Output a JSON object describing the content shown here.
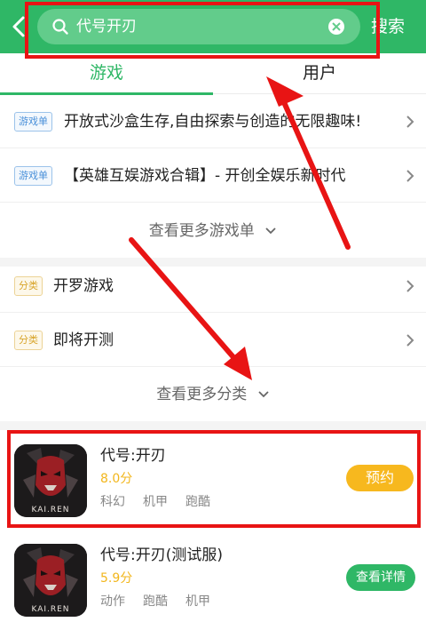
{
  "header": {
    "search_value": "代号开刃",
    "search_button": "搜索"
  },
  "tabs": [
    {
      "label": "游戏",
      "active": true
    },
    {
      "label": "用户",
      "active": false
    }
  ],
  "playlists": [
    {
      "tag": "游戏单",
      "text": "开放式沙盒生存,自由探索与创造的无限趣味!"
    },
    {
      "tag": "游戏单",
      "text": "【英雄互娱游戏合辑】- 开创全娱乐新时代"
    }
  ],
  "more_playlists": "查看更多游戏单",
  "categories": [
    {
      "tag": "分类",
      "text": "开罗游戏"
    },
    {
      "tag": "分类",
      "text": "即将开测"
    }
  ],
  "more_categories": "查看更多分类",
  "games": [
    {
      "name": "代号:开刃",
      "score": "8.0分",
      "tags": [
        "科幻",
        "机甲",
        "跑酷"
      ],
      "action": "预约",
      "icon_text": "KAI.REN"
    },
    {
      "name": "代号:开刃(测试服)",
      "score": "5.9分",
      "tags": [
        "动作",
        "跑酷",
        "机甲"
      ],
      "action": "查看详情",
      "icon_text": "KAI.REN"
    }
  ],
  "colors": {
    "brand_green": "#2fb766",
    "reserve_yellow": "#f7b81e",
    "annotation_red": "#e81414"
  }
}
